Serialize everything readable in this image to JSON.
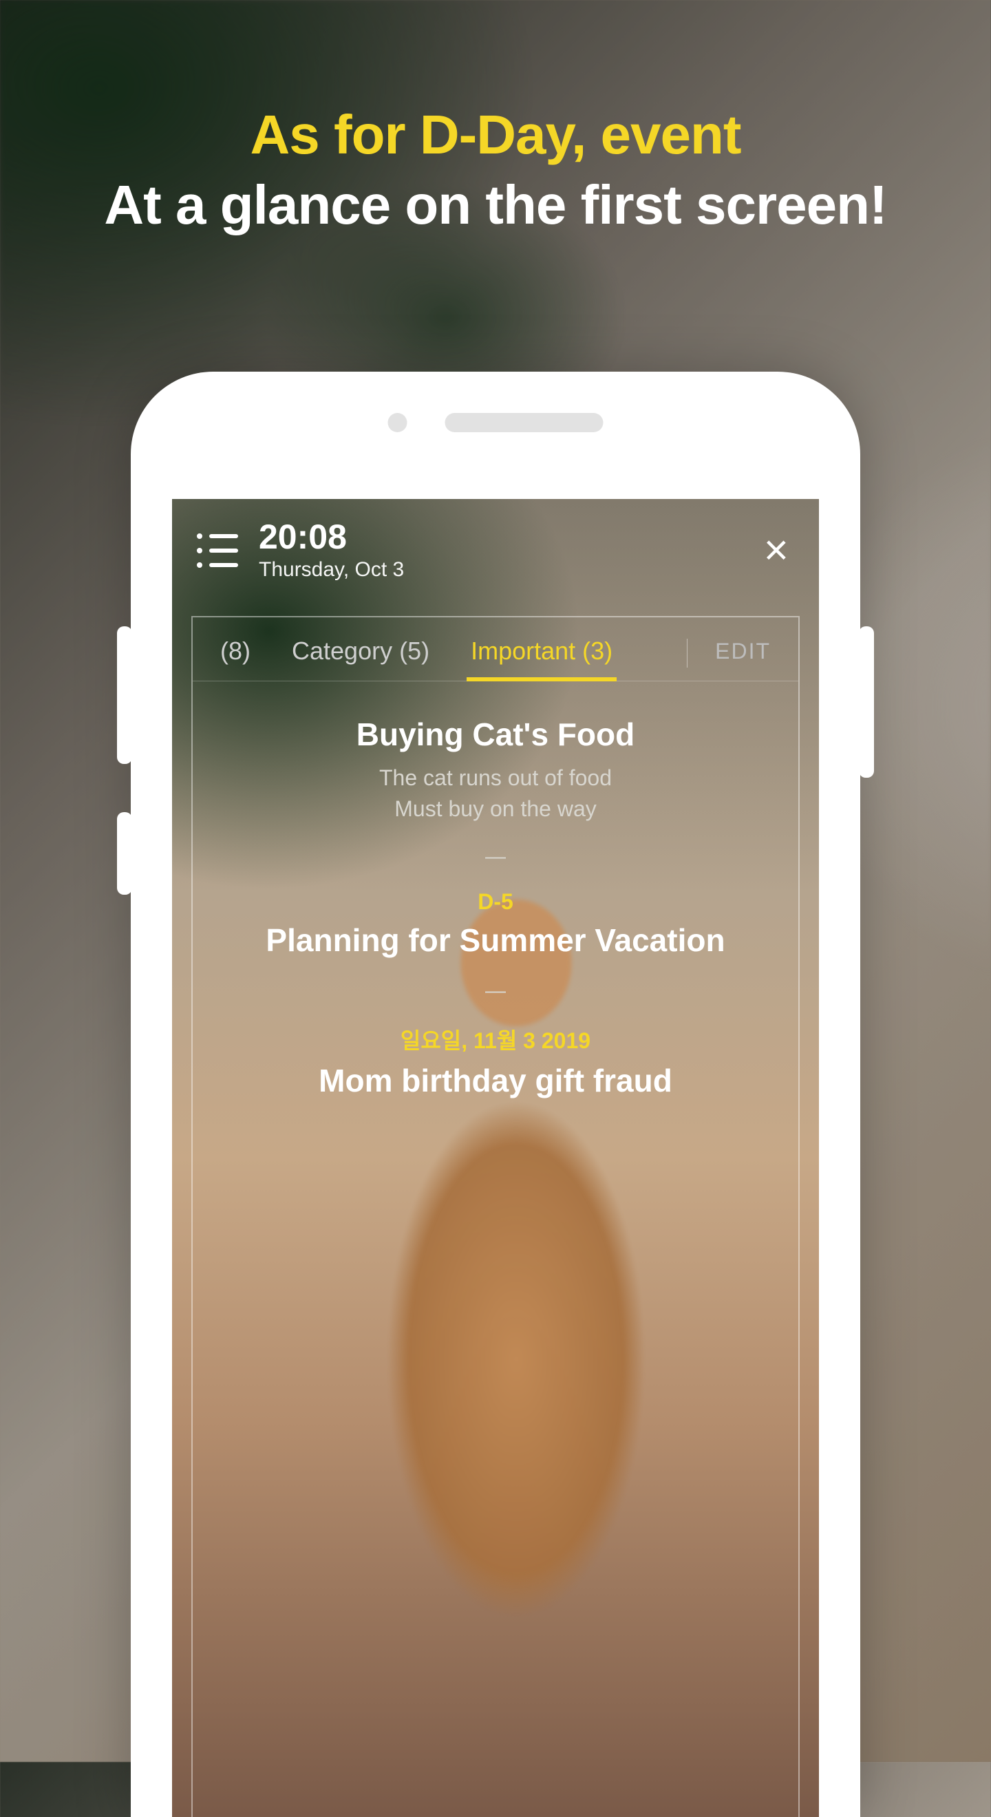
{
  "headline": {
    "line1": "As for D-Day, event",
    "line2": "At a glance on the first screen!"
  },
  "topbar": {
    "time": "20:08",
    "date": "Thursday, Oct 3"
  },
  "tabs": {
    "all_count_label": "(8)",
    "category_label": "Category (5)",
    "important_label": "Important (3)",
    "edit_label": "EDIT"
  },
  "entries": [
    {
      "dday": "",
      "date": "",
      "title": "Buying Cat's Food",
      "subtitle": "The cat runs out of food\nMust buy on the way"
    },
    {
      "dday": "D-5",
      "date": "",
      "title": "Planning for Summer Vacation",
      "subtitle": ""
    },
    {
      "dday": "",
      "date": "일요일, 11월 3 2019",
      "title": "Mom birthday gift fraud",
      "subtitle": ""
    }
  ],
  "colors": {
    "accent": "#F5D727"
  }
}
